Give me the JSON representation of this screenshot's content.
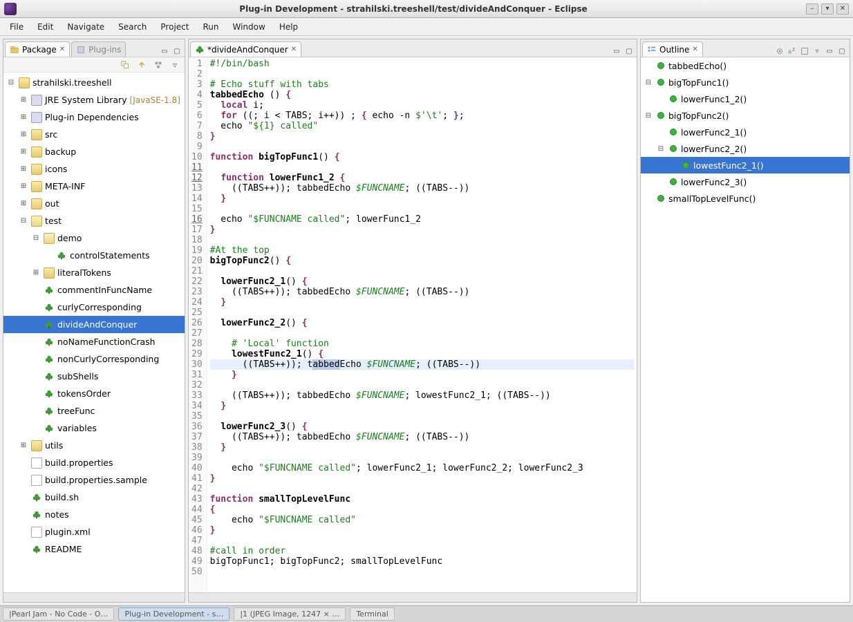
{
  "window": {
    "title": "Plug-in Development - strahilski.treeshell/test/divideAndConquer - Eclipse"
  },
  "menu": [
    "File",
    "Edit",
    "Navigate",
    "Search",
    "Project",
    "Run",
    "Window",
    "Help"
  ],
  "leftPanel": {
    "tabs": [
      {
        "label": "Package",
        "active": true
      },
      {
        "label": "Plug-ins",
        "active": false
      }
    ],
    "tree": [
      {
        "depth": 0,
        "exp": "minus",
        "icon": "project",
        "label": "strahilski.treeshell"
      },
      {
        "depth": 1,
        "exp": "plus",
        "icon": "jar",
        "label": "JRE System Library",
        "decorator": "[JavaSE-1.8]"
      },
      {
        "depth": 1,
        "exp": "plus",
        "icon": "package",
        "label": "Plug-in Dependencies"
      },
      {
        "depth": 1,
        "exp": "plus",
        "icon": "folder",
        "label": "src"
      },
      {
        "depth": 1,
        "exp": "plus",
        "icon": "folder",
        "label": "backup"
      },
      {
        "depth": 1,
        "exp": "plus",
        "icon": "folder",
        "label": "icons"
      },
      {
        "depth": 1,
        "exp": "plus",
        "icon": "folder",
        "label": "META-INF"
      },
      {
        "depth": 1,
        "exp": "plus",
        "icon": "folder",
        "label": "out"
      },
      {
        "depth": 1,
        "exp": "minus",
        "icon": "folder-open",
        "label": "test"
      },
      {
        "depth": 2,
        "exp": "minus",
        "icon": "folder-open",
        "label": "demo"
      },
      {
        "depth": 3,
        "exp": "",
        "icon": "shell",
        "label": "controlStatements"
      },
      {
        "depth": 2,
        "exp": "plus",
        "icon": "folder",
        "label": "literalTokens"
      },
      {
        "depth": 2,
        "exp": "",
        "icon": "shell",
        "label": "commentInFuncName"
      },
      {
        "depth": 2,
        "exp": "",
        "icon": "shell",
        "label": "curlyCorresponding"
      },
      {
        "depth": 2,
        "exp": "",
        "icon": "shell",
        "label": "divideAndConquer",
        "selected": true
      },
      {
        "depth": 2,
        "exp": "",
        "icon": "shell",
        "label": "noNameFunctionCrash"
      },
      {
        "depth": 2,
        "exp": "",
        "icon": "shell",
        "label": "nonCurlyCorresponding"
      },
      {
        "depth": 2,
        "exp": "",
        "icon": "shell",
        "label": "subShells"
      },
      {
        "depth": 2,
        "exp": "",
        "icon": "shell",
        "label": "tokensOrder"
      },
      {
        "depth": 2,
        "exp": "",
        "icon": "shell",
        "label": "treeFunc"
      },
      {
        "depth": 2,
        "exp": "",
        "icon": "shell",
        "label": "variables"
      },
      {
        "depth": 1,
        "exp": "plus",
        "icon": "folder",
        "label": "utils"
      },
      {
        "depth": 1,
        "exp": "",
        "icon": "file",
        "label": "build.properties"
      },
      {
        "depth": 1,
        "exp": "",
        "icon": "file",
        "label": "build.properties.sample"
      },
      {
        "depth": 1,
        "exp": "",
        "icon": "shell",
        "label": "build.sh"
      },
      {
        "depth": 1,
        "exp": "",
        "icon": "shell",
        "label": "notes"
      },
      {
        "depth": 1,
        "exp": "",
        "icon": "xml",
        "label": "plugin.xml"
      },
      {
        "depth": 1,
        "exp": "",
        "icon": "shell",
        "label": "README"
      }
    ]
  },
  "editor": {
    "tab": "*divideAndConquer",
    "highlightedLine": 30,
    "underlinedLines": [
      11,
      12,
      16
    ],
    "lines": [
      {
        "n": 1,
        "tokens": [
          [
            "cmt",
            "#!/bin/bash"
          ]
        ]
      },
      {
        "n": 2,
        "tokens": []
      },
      {
        "n": 3,
        "tokens": [
          [
            "cmt",
            "# Echo stuff with tabs"
          ]
        ]
      },
      {
        "n": 4,
        "tokens": [
          [
            "fn",
            "tabbedEcho"
          ],
          [
            "punc",
            " () "
          ],
          [
            "kw",
            "{"
          ]
        ]
      },
      {
        "n": 5,
        "tokens": [
          [
            "punc",
            "  "
          ],
          [
            "kw",
            "local"
          ],
          [
            "punc",
            " i;"
          ]
        ]
      },
      {
        "n": 6,
        "tokens": [
          [
            "punc",
            "  "
          ],
          [
            "kw",
            "for"
          ],
          [
            "punc",
            " ((; i < TABS; i++)) ; "
          ],
          [
            "kw",
            "{"
          ],
          [
            "punc",
            " echo -n "
          ],
          [
            "str",
            "$'\\t'"
          ],
          [
            "punc",
            "; "
          ],
          [
            "kw",
            "}"
          ],
          [
            "punc",
            ";"
          ]
        ]
      },
      {
        "n": 7,
        "tokens": [
          [
            "punc",
            "  echo "
          ],
          [
            "str",
            "\"${1} called\""
          ]
        ]
      },
      {
        "n": 8,
        "tokens": [
          [
            "kw",
            "}"
          ]
        ]
      },
      {
        "n": 9,
        "tokens": []
      },
      {
        "n": 10,
        "tokens": [
          [
            "kw",
            "function "
          ],
          [
            "fn",
            "bigTopFunc1"
          ],
          [
            "punc",
            "() "
          ],
          [
            "kw",
            "{"
          ]
        ]
      },
      {
        "n": 11,
        "tokens": []
      },
      {
        "n": 12,
        "tokens": [
          [
            "punc",
            "  "
          ],
          [
            "kw",
            "function "
          ],
          [
            "fn",
            "lowerFunc1_2"
          ],
          [
            "punc",
            " "
          ],
          [
            "kw",
            "{"
          ]
        ]
      },
      {
        "n": 13,
        "tokens": [
          [
            "punc",
            "    ((TABS++)); tabbedEcho "
          ],
          [
            "var",
            "$FUNCNAME"
          ],
          [
            "punc",
            "; ((TABS--))"
          ]
        ]
      },
      {
        "n": 14,
        "tokens": [
          [
            "punc",
            "  "
          ],
          [
            "kw",
            "}"
          ]
        ]
      },
      {
        "n": 15,
        "tokens": []
      },
      {
        "n": 16,
        "tokens": [
          [
            "punc",
            "  echo "
          ],
          [
            "str",
            "\"$FUNCNAME called\""
          ],
          [
            "punc",
            "; lowerFunc1_2"
          ]
        ]
      },
      {
        "n": 17,
        "tokens": [
          [
            "kw",
            "}"
          ]
        ]
      },
      {
        "n": 18,
        "tokens": []
      },
      {
        "n": 19,
        "tokens": [
          [
            "cmt",
            "#At the top"
          ]
        ]
      },
      {
        "n": 20,
        "tokens": [
          [
            "fn",
            "bigTopFunc2"
          ],
          [
            "punc",
            "() "
          ],
          [
            "kw",
            "{"
          ]
        ]
      },
      {
        "n": 21,
        "tokens": []
      },
      {
        "n": 22,
        "tokens": [
          [
            "punc",
            "  "
          ],
          [
            "fn",
            "lowerFunc2_1"
          ],
          [
            "punc",
            "() "
          ],
          [
            "kw",
            "{"
          ]
        ]
      },
      {
        "n": 23,
        "tokens": [
          [
            "punc",
            "    ((TABS++)); tabbedEcho "
          ],
          [
            "var",
            "$FUNCNAME"
          ],
          [
            "punc",
            "; ((TABS--))"
          ]
        ]
      },
      {
        "n": 24,
        "tokens": [
          [
            "punc",
            "  "
          ],
          [
            "kw",
            "}"
          ]
        ]
      },
      {
        "n": 25,
        "tokens": []
      },
      {
        "n": 26,
        "tokens": [
          [
            "punc",
            "  "
          ],
          [
            "fn",
            "lowerFunc2_2"
          ],
          [
            "punc",
            "() "
          ],
          [
            "kw",
            "{"
          ]
        ]
      },
      {
        "n": 27,
        "tokens": []
      },
      {
        "n": 28,
        "tokens": [
          [
            "punc",
            "    "
          ],
          [
            "cmt",
            "# 'Local' function"
          ]
        ]
      },
      {
        "n": 29,
        "tokens": [
          [
            "punc",
            "    "
          ],
          [
            "fn",
            "lowestFunc2_1"
          ],
          [
            "punc",
            "() "
          ],
          [
            "kw",
            "{"
          ]
        ]
      },
      {
        "n": 30,
        "tokens": [
          [
            "punc",
            "      ((TABS++)); t"
          ],
          [
            "sel",
            "abbed"
          ],
          [
            "punc",
            "Echo "
          ],
          [
            "var",
            "$FUNCNAME"
          ],
          [
            "punc",
            "; ((TABS--))"
          ]
        ]
      },
      {
        "n": 31,
        "tokens": [
          [
            "punc",
            "    "
          ],
          [
            "kw",
            "}"
          ]
        ]
      },
      {
        "n": 32,
        "tokens": []
      },
      {
        "n": 33,
        "tokens": [
          [
            "punc",
            "    ((TABS++)); tabbedEcho "
          ],
          [
            "var",
            "$FUNCNAME"
          ],
          [
            "punc",
            "; lowestFunc2_1; ((TABS--))"
          ]
        ]
      },
      {
        "n": 34,
        "tokens": [
          [
            "punc",
            "  "
          ],
          [
            "kw",
            "}"
          ]
        ]
      },
      {
        "n": 35,
        "tokens": []
      },
      {
        "n": 36,
        "tokens": [
          [
            "punc",
            "  "
          ],
          [
            "fn",
            "lowerFunc2_3"
          ],
          [
            "punc",
            "() "
          ],
          [
            "kw",
            "{"
          ]
        ]
      },
      {
        "n": 37,
        "tokens": [
          [
            "punc",
            "    ((TABS++)); tabbedEcho "
          ],
          [
            "var",
            "$FUNCNAME"
          ],
          [
            "punc",
            "; ((TABS--))"
          ]
        ]
      },
      {
        "n": 38,
        "tokens": [
          [
            "punc",
            "  "
          ],
          [
            "kw",
            "}"
          ]
        ]
      },
      {
        "n": 39,
        "tokens": []
      },
      {
        "n": 40,
        "tokens": [
          [
            "punc",
            "    echo "
          ],
          [
            "str",
            "\"$FUNCNAME called\""
          ],
          [
            "punc",
            "; lowerFunc2_1; lowerFunc2_2; lowerFunc2_3"
          ]
        ]
      },
      {
        "n": 41,
        "tokens": [
          [
            "kw",
            "}"
          ]
        ]
      },
      {
        "n": 42,
        "tokens": []
      },
      {
        "n": 43,
        "tokens": [
          [
            "kw",
            "function "
          ],
          [
            "fn",
            "smallTopLevelFunc"
          ]
        ]
      },
      {
        "n": 44,
        "tokens": [
          [
            "kw",
            "{"
          ]
        ]
      },
      {
        "n": 45,
        "tokens": [
          [
            "punc",
            "    echo "
          ],
          [
            "str",
            "\"$FUNCNAME called\""
          ]
        ]
      },
      {
        "n": 46,
        "tokens": [
          [
            "kw",
            "}"
          ]
        ]
      },
      {
        "n": 47,
        "tokens": []
      },
      {
        "n": 48,
        "tokens": [
          [
            "cmt",
            "#call in order"
          ]
        ]
      },
      {
        "n": 49,
        "tokens": [
          [
            "punc",
            "bigTopFunc1; bigTopFunc2; smallTopLevelFunc"
          ]
        ]
      },
      {
        "n": 50,
        "tokens": []
      }
    ]
  },
  "outline": {
    "title": "Outline",
    "items": [
      {
        "depth": 0,
        "exp": "",
        "label": "tabbedEcho()"
      },
      {
        "depth": 0,
        "exp": "minus",
        "label": "bigTopFunc1()"
      },
      {
        "depth": 1,
        "exp": "",
        "label": "lowerFunc1_2()"
      },
      {
        "depth": 0,
        "exp": "minus",
        "label": "bigTopFunc2()"
      },
      {
        "depth": 1,
        "exp": "",
        "label": "lowerFunc2_1()"
      },
      {
        "depth": 1,
        "exp": "minus",
        "label": "lowerFunc2_2()"
      },
      {
        "depth": 2,
        "exp": "",
        "label": "lowestFunc2_1()",
        "selected": true
      },
      {
        "depth": 1,
        "exp": "",
        "label": "lowerFunc2_3()"
      },
      {
        "depth": 0,
        "exp": "",
        "label": "smallTopLevelFunc()"
      }
    ]
  },
  "taskbar": [
    {
      "label": "|Pearl Jam - No Code - O…"
    },
    {
      "label": "Plug-in Development - s…",
      "active": true
    },
    {
      "label": "|1 (JPEG Image, 1247 × …"
    },
    {
      "label": "Terminal"
    }
  ]
}
